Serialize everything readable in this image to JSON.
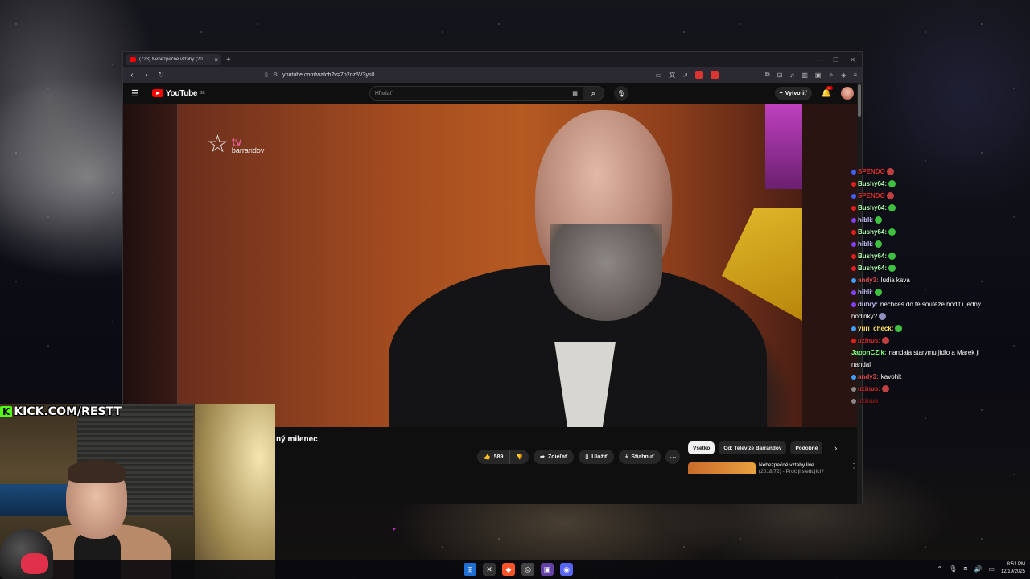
{
  "browser": {
    "tab_title": "(723) Nebezpečné vztahy (20",
    "new_tab": "+",
    "url": "youtube.com/watch?v=7n2oz5V3ys0",
    "win_min": "—",
    "win_max": "☐",
    "win_close": "✕"
  },
  "youtube": {
    "logo_text": "YouTube",
    "region": "SK",
    "search_placeholder": "Hľadať",
    "create_label": "Vytvoriť",
    "notif_badge": "9+",
    "video": {
      "channel_logo_tv": "tv",
      "channel_logo_brand": "barrandov",
      "title_fragment": "ný milenec"
    },
    "actions": {
      "like_count": "589",
      "share": "Zdieľať",
      "save": "Uložiť",
      "download": "Stiahnuť"
    },
    "chips": [
      "Všetko",
      "Od: Televize Barrandov",
      "Podobné"
    ],
    "recommendation": {
      "title": "Nebezpečné vztahy live",
      "subtitle": "(2018/72) - Proč ji sledující?"
    }
  },
  "overlay": {
    "kick_url": "KICK.COM/RESTT",
    "kick_k": "K"
  },
  "chat": [
    {
      "user": "SPENDO",
      "text": "",
      "color": "#e03030",
      "badge": "#4060ff",
      "emote": "#c04040"
    },
    {
      "user": "Bushy64:",
      "text": "",
      "color": "#b0ffb0",
      "badge": "#e02020",
      "emote": "#40c040"
    },
    {
      "user": "SPENDO",
      "text": "",
      "color": "#e03030",
      "badge": "#4060ff",
      "emote": "#c04040"
    },
    {
      "user": "Bushy64:",
      "text": "",
      "color": "#b0ffb0",
      "badge": "#e02020",
      "emote": "#40c040"
    },
    {
      "user": "hibli:",
      "text": "",
      "color": "#c8c8ff",
      "badge": "#8040ff",
      "emote": "#40c040"
    },
    {
      "user": "Bushy64:",
      "text": "",
      "color": "#b0ffb0",
      "badge": "#e02020",
      "emote": "#40c040"
    },
    {
      "user": "hibli:",
      "text": "",
      "color": "#c8c8ff",
      "badge": "#8040ff",
      "emote": "#40c040"
    },
    {
      "user": "Bushy64:",
      "text": "",
      "color": "#b0ffb0",
      "badge": "#e02020",
      "emote": "#40c040"
    },
    {
      "user": "Bushy64:",
      "text": "",
      "color": "#b0ffb0",
      "badge": "#e02020",
      "emote": "#40c040"
    },
    {
      "user": "andy3:",
      "text": "ludia kava",
      "color": "#e05050",
      "badge": "#40a0ff",
      "emote": ""
    },
    {
      "user": "hibli:",
      "text": "",
      "color": "#c8c8ff",
      "badge": "#8040ff",
      "emote": "#40c040"
    },
    {
      "user": "dubry:",
      "text": "nechceš do té soutěže hodit i jedny hodinky?",
      "color": "#c8c8ff",
      "badge": "#8040ff",
      "emote": "#9090c0"
    },
    {
      "user": "yuri_check:",
      "text": "",
      "color": "#ffe060",
      "badge": "#40a0ff",
      "emote": "#40c040"
    },
    {
      "user": "uzinus:",
      "text": "",
      "color": "#e03030",
      "badge": "#e02020",
      "emote": "#c04040"
    },
    {
      "user": "JaponCZik:",
      "text": "nandala starymu jidlo a Marek ji nandal",
      "color": "#80ff80",
      "badge": "",
      "emote": ""
    },
    {
      "user": "andy3:",
      "text": "kavohlt",
      "color": "#e05050",
      "badge": "#40a0ff",
      "emote": ""
    },
    {
      "user": "uzinus:",
      "text": "",
      "color": "#e03030",
      "badge": "#888888",
      "emote": "#c04040"
    },
    {
      "user": "uzinus",
      "text": "",
      "color": "#a02020",
      "badge": "#888888",
      "emote": ""
    }
  ],
  "taskbar": {
    "time": "8:51 PM",
    "date": "12/19/2025"
  }
}
